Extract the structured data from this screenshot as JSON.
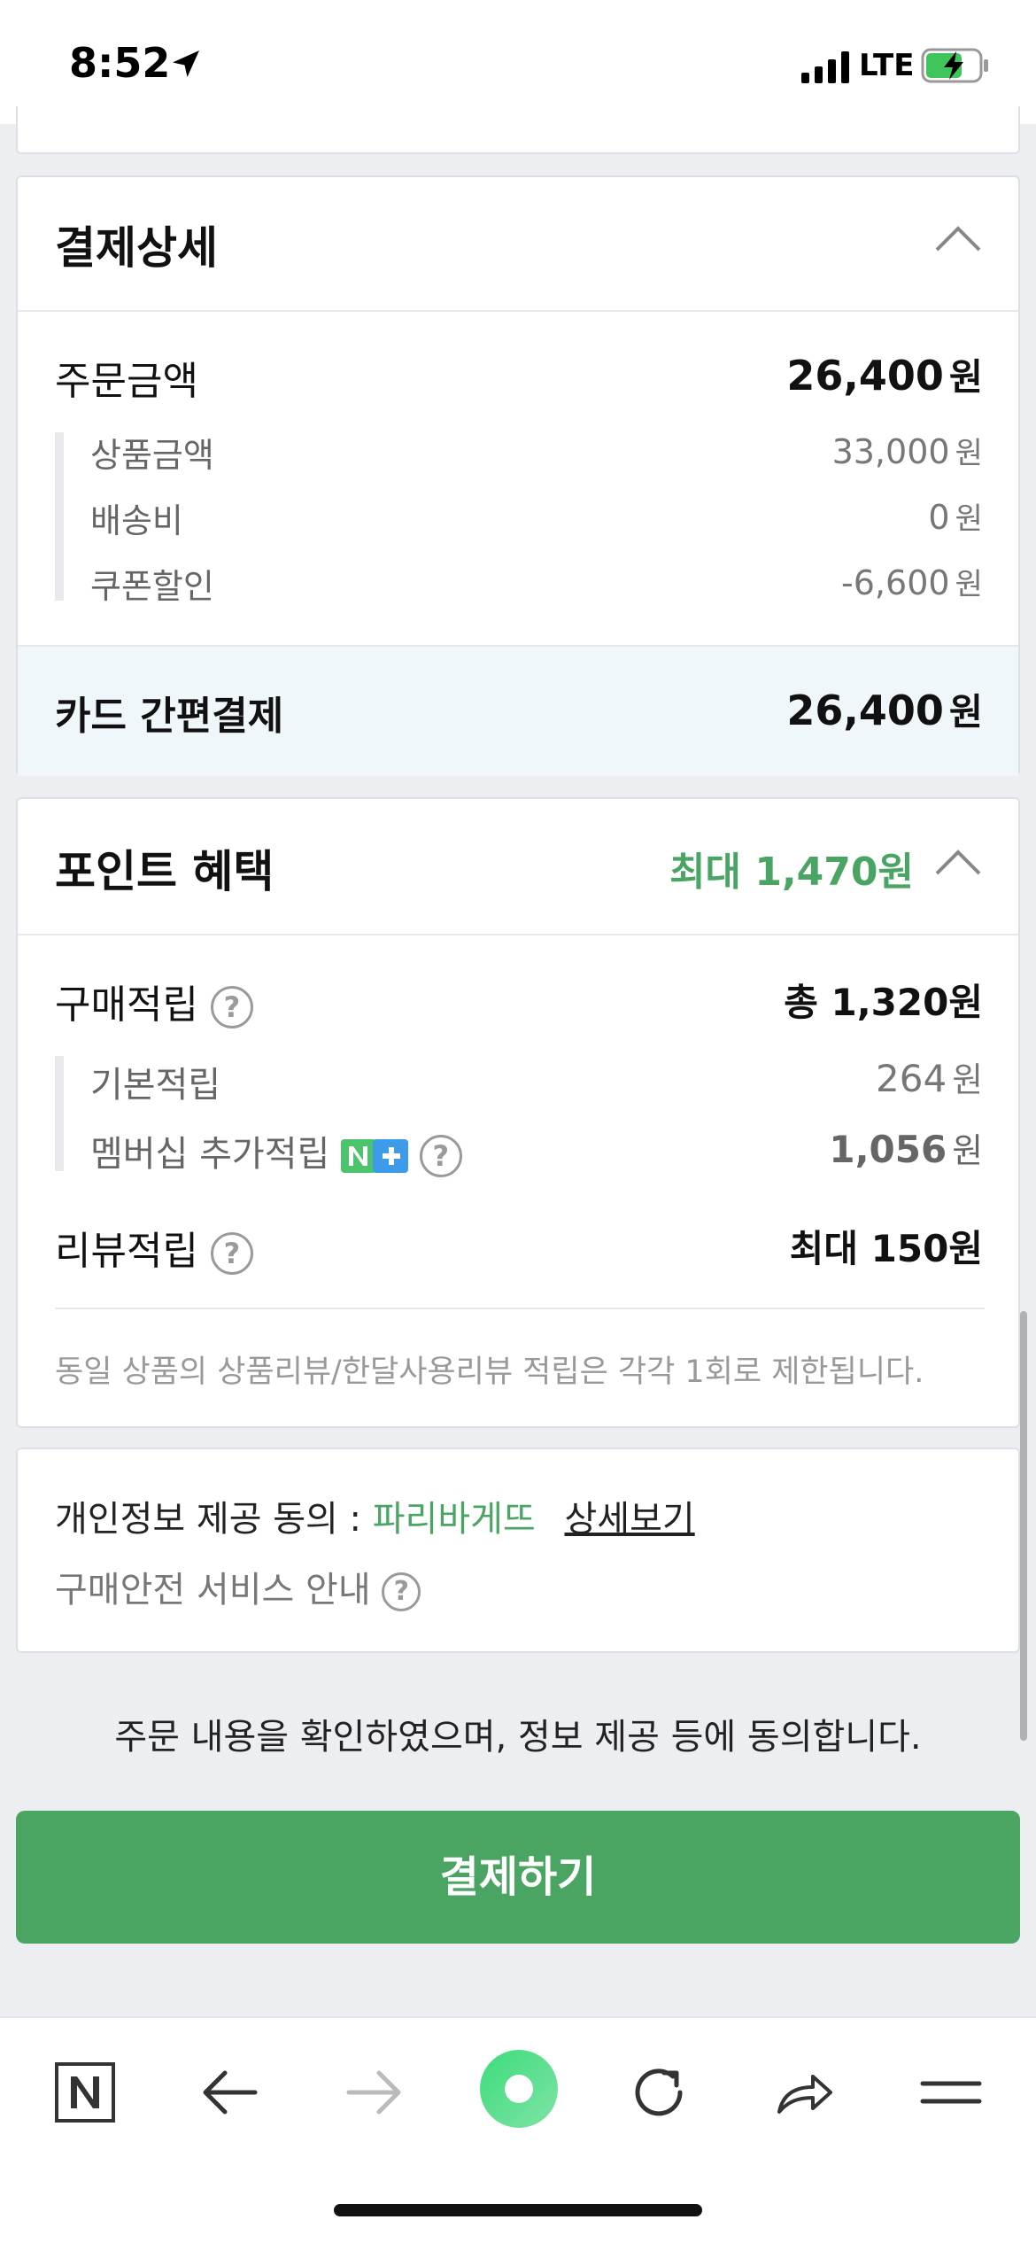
{
  "status_bar": {
    "time": "8:52",
    "network": "LTE"
  },
  "payment_detail": {
    "title": "결제상세",
    "order_amount_label": "주문금액",
    "order_amount_value": "26,400",
    "currency": "원",
    "items": [
      {
        "label": "상품금액",
        "value": "33,000"
      },
      {
        "label": "배송비",
        "value": "0"
      },
      {
        "label": "쿠폰할인",
        "value": "-6,600"
      }
    ],
    "method_label": "카드 간편결제",
    "method_value": "26,400"
  },
  "point_benefit": {
    "title": "포인트 혜택",
    "max_label": "최대 1,470원",
    "purchase_label": "구매적립",
    "purchase_total": "총 1,320원",
    "basic_label": "기본적립",
    "basic_value": "264",
    "membership_label": "멤버십 추가적립",
    "membership_value": "1,056",
    "review_label": "리뷰적립",
    "review_value": "최대 150원",
    "note": "동일 상품의 상품리뷰/한달사용리뷰 적립은 각각 1회로 제한됩니다."
  },
  "privacy": {
    "consent_label": "개인정보 제공 동의 :",
    "seller": "파리바게뜨",
    "detail_link": "상세보기",
    "safety_label": "구매안전 서비스 안내"
  },
  "agree_text": "주문 내용을 확인하였으며, 정보 제공 등에 동의합니다.",
  "pay_button": "결제하기",
  "colors": {
    "accent_green": "#4aa563",
    "band_blue": "#eff7fb"
  },
  "toolbar_icons": [
    "naver-home-icon",
    "back-arrow-icon",
    "forward-arrow-icon",
    "green-dot-icon",
    "reload-icon",
    "share-icon",
    "menu-icon"
  ]
}
